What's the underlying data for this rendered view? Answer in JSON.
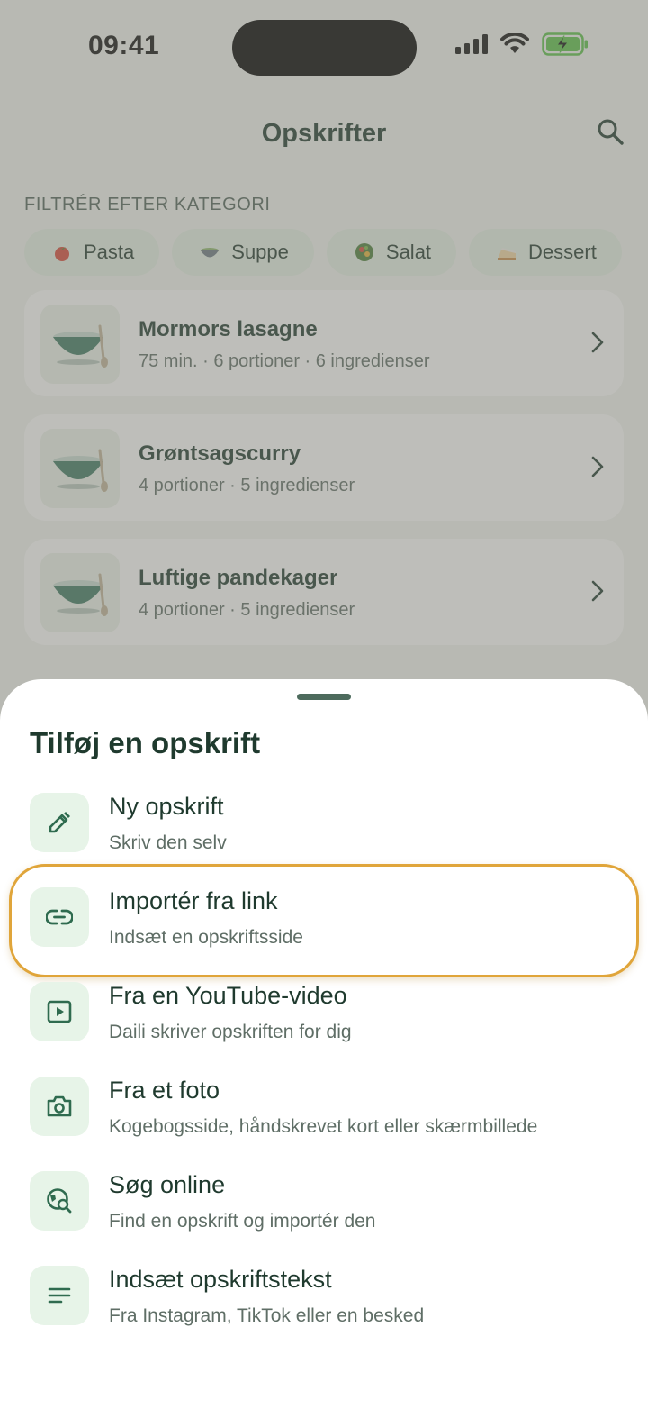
{
  "status_bar": {
    "time": "09:41"
  },
  "app_bar": {
    "title": "Opskrifter"
  },
  "filter": {
    "label": "FILTRÉR EFTER KATEGORI",
    "chips": [
      {
        "label": "Pasta",
        "icon": "tomato-icon"
      },
      {
        "label": "Suppe",
        "icon": "soup-bowl-icon"
      },
      {
        "label": "Salat",
        "icon": "salad-icon"
      },
      {
        "label": "Dessert",
        "icon": "cake-icon"
      }
    ]
  },
  "recipes": [
    {
      "title": "Mormors lasagne",
      "meta": "75 min. · 6 portioner · 6 ingredienser"
    },
    {
      "title": "Grøntsagscurry",
      "meta": "4 portioner · 5 ingredienser"
    },
    {
      "title": "Luftige pandekager",
      "meta": "4 portioner · 5 ingredienser"
    }
  ],
  "sheet": {
    "title": "Tilføj en opskrift",
    "options": [
      {
        "title": "Ny opskrift",
        "subtitle": "Skriv den selv",
        "icon": "pencil-icon"
      },
      {
        "title": "Importér fra link",
        "subtitle": "Indsæt en opskriftsside",
        "icon": "link-icon",
        "highlighted": true
      },
      {
        "title": "Fra en YouTube-video",
        "subtitle": "Daili skriver opskriften for dig",
        "icon": "video-play-icon"
      },
      {
        "title": "Fra et foto",
        "subtitle": "Kogebogsside, håndskrevet kort eller skærmbillede",
        "icon": "camera-icon"
      },
      {
        "title": "Søg online",
        "subtitle": "Find en opskrift og importér den",
        "icon": "globe-search-icon"
      },
      {
        "title": "Indsæt opskriftstekst",
        "subtitle": "Fra Instagram, TikTok eller en besked",
        "icon": "text-lines-icon"
      }
    ]
  },
  "colors": {
    "primary": "#2f6b4f",
    "icon_bg": "#e7f4e8",
    "highlight_border": "#e0a53a",
    "battery": "#5cc24a"
  }
}
